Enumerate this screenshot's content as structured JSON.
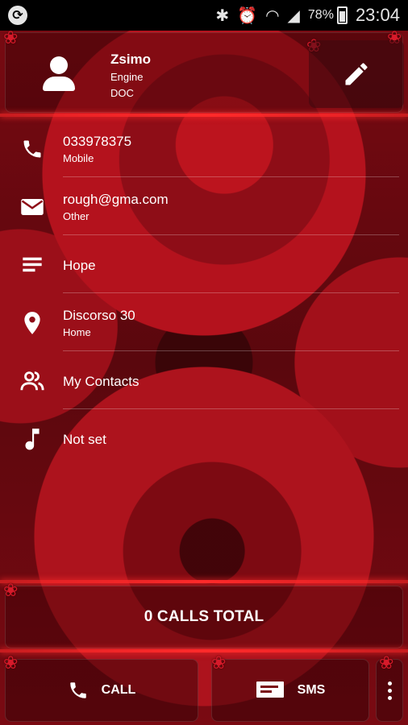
{
  "status_bar": {
    "battery": "78%",
    "time": "23:04"
  },
  "contact": {
    "name": "Zsimo",
    "line1": "Engine",
    "line2": "DOC"
  },
  "details": [
    {
      "icon": "phone-icon",
      "value": "033978375",
      "label": "Mobile"
    },
    {
      "icon": "email-icon",
      "value": "rough@gma.com",
      "label": "Other"
    },
    {
      "icon": "notes-icon",
      "value": "Hope",
      "label": ""
    },
    {
      "icon": "location-icon",
      "value": "Discorso 30",
      "label": "Home"
    },
    {
      "icon": "group-icon",
      "value": "My Contacts",
      "label": ""
    },
    {
      "icon": "music-note-icon",
      "value": "Not set",
      "label": ""
    }
  ],
  "summary": {
    "calls_total": "0 CALLS TOTAL"
  },
  "actions": {
    "call_label": "CALL",
    "sms_label": "SMS"
  },
  "colors": {
    "accent_glow": "#ff2a2a",
    "background": "#8e0d17"
  }
}
